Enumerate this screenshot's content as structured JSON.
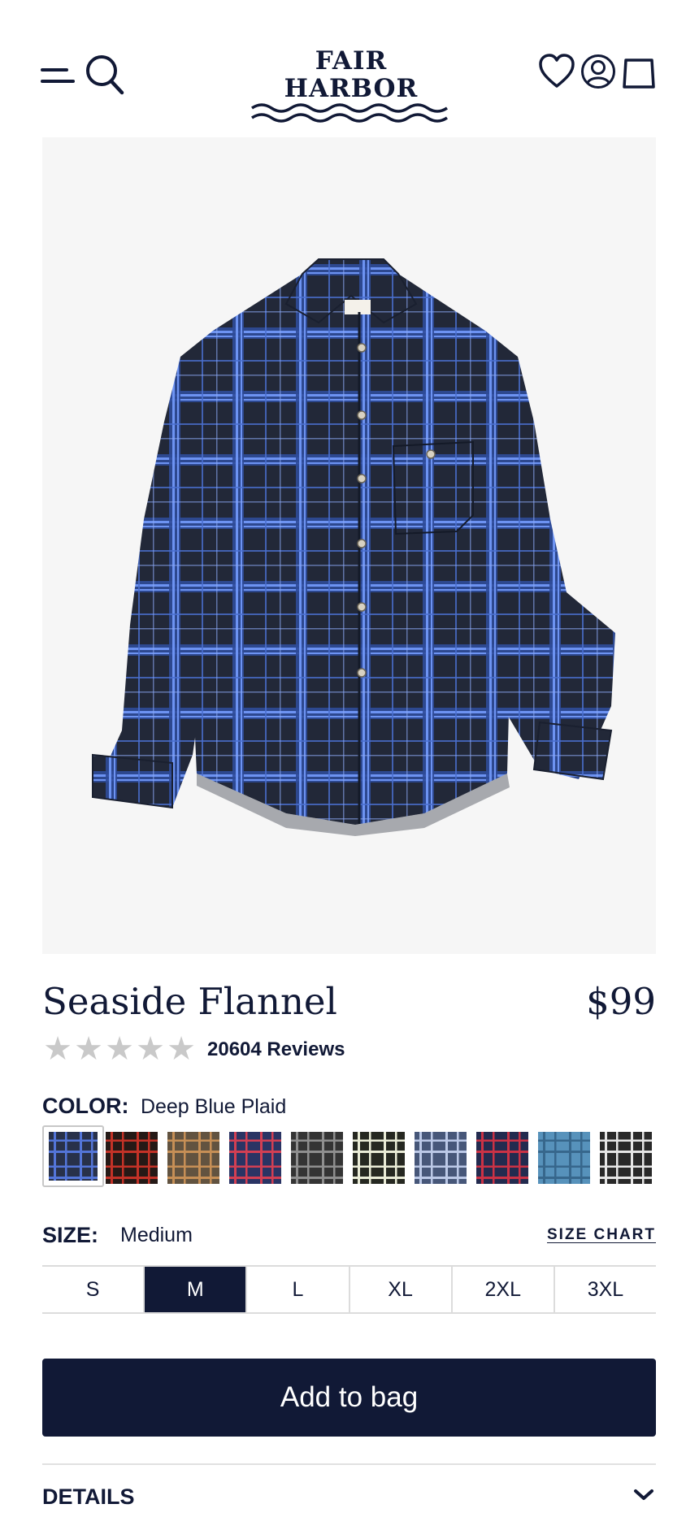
{
  "header": {
    "logo_text": "FAIR HARBOR",
    "icons": [
      "menu-icon",
      "search-icon",
      "heart-icon",
      "account-icon",
      "bag-icon"
    ]
  },
  "product": {
    "name": "Seaside Flannel",
    "price": "$99",
    "rating_stars": 5,
    "reviews": "20604 Reviews",
    "color_label": "COLOR:",
    "color_value": "Deep Blue Plaid",
    "swatches": [
      {
        "name": "Deep Blue Plaid",
        "base": "#1d2741",
        "stripe": "#4a6ed6",
        "selected": true
      },
      {
        "name": "Red Black Plaid",
        "base": "#1a0d0a",
        "stripe": "#c0281c",
        "selected": false
      },
      {
        "name": "Brown Tan Plaid",
        "base": "#5a4a36",
        "stripe": "#c48a4e",
        "selected": false
      },
      {
        "name": "Navy Red Plaid",
        "base": "#1f2a5c",
        "stripe": "#d0354a",
        "selected": false
      },
      {
        "name": "Grey Black Plaid",
        "base": "#2a2a2a",
        "stripe": "#8a8a8a",
        "selected": false
      },
      {
        "name": "Cream Black Plaid",
        "base": "#1b1d16",
        "stripe": "#e9ecd5",
        "selected": false
      },
      {
        "name": "Blue Grey Plaid",
        "base": "#3e4f72",
        "stripe": "#b9c7e6",
        "selected": false
      },
      {
        "name": "Red Navy Plaid",
        "base": "#182046",
        "stripe": "#c9283c",
        "selected": false
      },
      {
        "name": "Light Blue Plaid",
        "base": "#4f8db8",
        "stripe": "#2d5f86",
        "selected": false
      },
      {
        "name": "Black White Plaid",
        "base": "#1e1e1e",
        "stripe": "#e5e5e5",
        "selected": false
      }
    ],
    "size_label": "SIZE:",
    "size_value": "Medium",
    "size_chart": "SIZE CHART",
    "sizes": [
      {
        "label": "S",
        "active": false
      },
      {
        "label": "M",
        "active": true
      },
      {
        "label": "L",
        "active": false
      },
      {
        "label": "XL",
        "active": false
      },
      {
        "label": "2XL",
        "active": false
      },
      {
        "label": "3XL",
        "active": false
      }
    ],
    "add_to_bag": "Add to bag",
    "details_label": "DETAILS"
  },
  "colors": {
    "navy": "#111936",
    "hero_bg": "#f6f6f6",
    "star": "#c9c9c9",
    "shirt_base": "#242b3f",
    "shirt_stripe": "#4a72dc"
  }
}
